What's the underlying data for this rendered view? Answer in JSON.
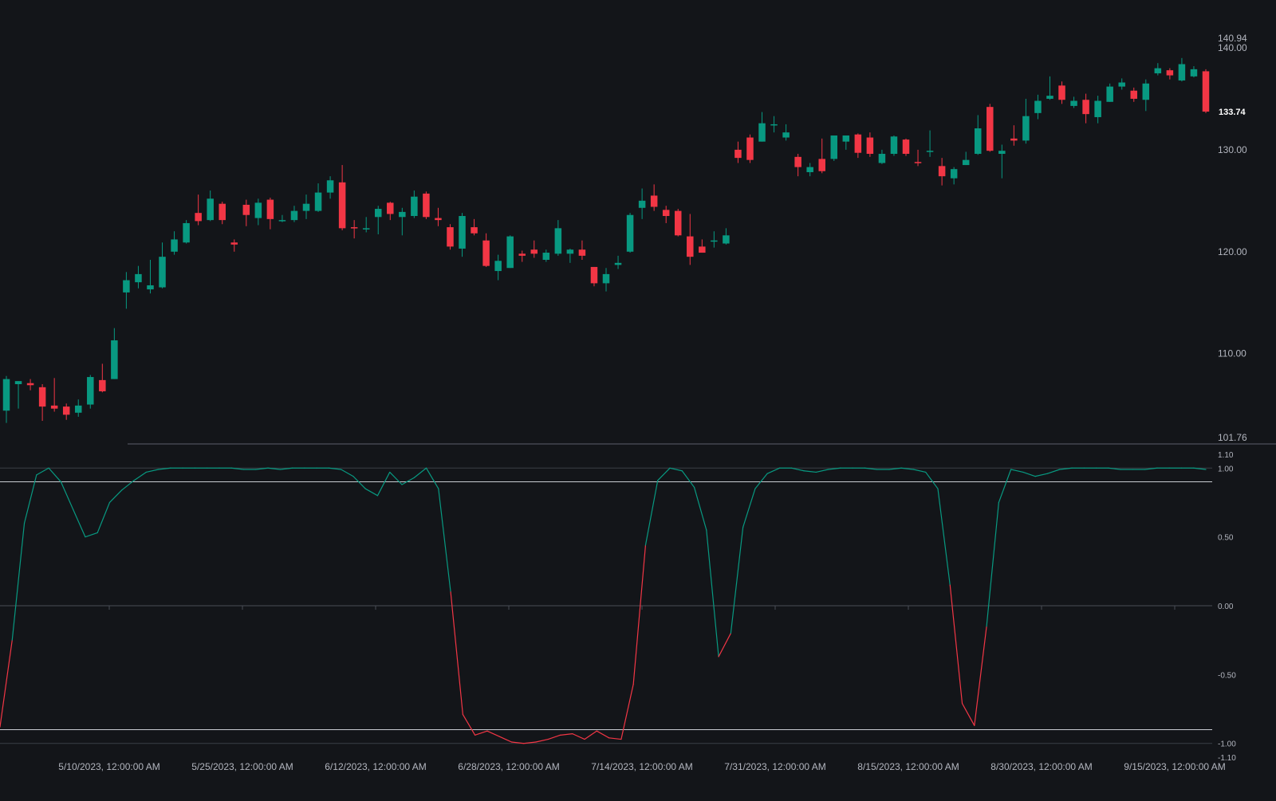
{
  "chart_data": [
    {
      "type": "candlestick",
      "panel": "price",
      "ylim": [
        101.76,
        140.94
      ],
      "y_ticks": [
        110,
        120,
        130,
        140
      ],
      "y_tick_labels": [
        "110.00",
        "120.00",
        "130.00",
        "140.00"
      ],
      "axis_extremes": [
        "140.94",
        "101.76"
      ],
      "last_price": 133.74,
      "last_price_label": "133.74",
      "candles": [
        [
          104.4,
          107.5,
          103.2,
          107.8
        ],
        [
          107.0,
          107.3,
          104.6,
          107.3
        ],
        [
          107.1,
          106.9,
          106.4,
          107.5
        ],
        [
          106.7,
          104.8,
          103.4,
          107.0
        ],
        [
          104.9,
          104.6,
          104.3,
          107.6
        ],
        [
          104.8,
          104.0,
          103.5,
          105.1
        ],
        [
          104.2,
          104.9,
          103.8,
          105.5
        ],
        [
          105.0,
          107.7,
          104.6,
          107.9
        ],
        [
          107.4,
          106.3,
          106.2,
          109.0
        ],
        [
          107.5,
          111.3,
          107.5,
          112.5
        ],
        [
          116.0,
          117.2,
          114.4,
          118.0
        ],
        [
          117.0,
          117.8,
          116.4,
          118.6
        ],
        [
          116.3,
          116.7,
          115.9,
          119.2
        ],
        [
          116.5,
          119.5,
          116.4,
          120.9
        ],
        [
          120.0,
          121.2,
          119.7,
          122.0
        ],
        [
          120.9,
          122.8,
          120.8,
          123.1
        ],
        [
          123.8,
          123.0,
          122.6,
          125.6
        ],
        [
          123.1,
          125.2,
          123.0,
          126.0
        ],
        [
          124.7,
          123.1,
          122.7,
          124.9
        ],
        [
          120.9,
          120.7,
          120.0,
          121.2
        ],
        [
          124.6,
          123.6,
          122.5,
          125.1
        ],
        [
          123.3,
          124.8,
          122.6,
          125.2
        ],
        [
          125.1,
          123.2,
          122.2,
          125.3
        ],
        [
          123.0,
          123.1,
          122.9,
          123.6
        ],
        [
          123.1,
          124.0,
          122.9,
          124.5
        ],
        [
          124.0,
          124.7,
          123.2,
          125.6
        ],
        [
          124.0,
          125.8,
          123.9,
          126.7
        ],
        [
          125.8,
          127.0,
          125.2,
          127.4
        ],
        [
          126.8,
          122.3,
          122.1,
          128.5
        ],
        [
          122.4,
          122.3,
          121.3,
          123.1
        ],
        [
          122.3,
          122.3,
          121.9,
          123.4
        ],
        [
          123.4,
          124.2,
          121.7,
          124.5
        ],
        [
          124.8,
          123.7,
          123.1,
          124.9
        ],
        [
          123.4,
          123.9,
          121.6,
          124.3
        ],
        [
          123.5,
          125.4,
          123.3,
          126.0
        ],
        [
          125.7,
          123.4,
          123.2,
          125.9
        ],
        [
          123.3,
          123.1,
          122.5,
          124.3
        ],
        [
          122.4,
          120.5,
          120.2,
          122.7
        ],
        [
          120.3,
          123.5,
          119.5,
          123.8
        ],
        [
          122.4,
          121.8,
          121.6,
          123.2
        ],
        [
          121.1,
          118.6,
          118.5,
          121.8
        ],
        [
          118.1,
          119.1,
          117.2,
          119.7
        ],
        [
          118.4,
          121.5,
          118.4,
          121.6
        ],
        [
          119.8,
          119.6,
          119.0,
          120.1
        ],
        [
          120.2,
          119.8,
          119.4,
          121.1
        ],
        [
          119.2,
          119.9,
          119.0,
          120.2
        ],
        [
          119.8,
          122.3,
          119.6,
          123.1
        ],
        [
          119.8,
          120.2,
          118.9,
          120.3
        ],
        [
          120.2,
          119.6,
          119.2,
          121.1
        ],
        [
          118.5,
          116.9,
          116.6,
          118.5
        ],
        [
          116.9,
          117.8,
          116.1,
          118.4
        ],
        [
          118.7,
          118.9,
          118.3,
          119.6
        ],
        [
          120.0,
          123.6,
          119.9,
          123.8
        ],
        [
          124.3,
          125.0,
          123.2,
          126.2
        ],
        [
          125.5,
          124.4,
          124.0,
          126.6
        ],
        [
          124.1,
          123.5,
          122.8,
          124.5
        ],
        [
          124.0,
          121.6,
          121.5,
          124.2
        ],
        [
          121.5,
          119.5,
          118.7,
          123.7
        ],
        [
          120.5,
          119.9,
          119.9,
          121.2
        ],
        [
          121.1,
          121.1,
          120.4,
          122.0
        ],
        [
          120.8,
          121.6,
          120.7,
          122.3
        ],
        [
          130.0,
          129.2,
          128.7,
          130.8
        ],
        [
          131.2,
          129.0,
          128.7,
          131.5
        ],
        [
          130.8,
          132.6,
          130.8,
          133.7
        ],
        [
          132.4,
          132.5,
          131.7,
          133.3
        ],
        [
          131.2,
          131.7,
          130.9,
          132.5
        ],
        [
          129.3,
          128.3,
          127.4,
          129.6
        ],
        [
          127.8,
          128.3,
          127.4,
          128.7
        ],
        [
          129.1,
          127.9,
          127.7,
          131.1
        ],
        [
          129.1,
          131.4,
          128.9,
          131.4
        ],
        [
          130.8,
          131.4,
          130.0,
          131.4
        ],
        [
          131.5,
          129.7,
          129.2,
          131.6
        ],
        [
          131.2,
          129.6,
          129.3,
          131.7
        ],
        [
          128.7,
          129.6,
          128.6,
          130.0
        ],
        [
          129.6,
          131.3,
          129.4,
          131.4
        ],
        [
          131.0,
          129.6,
          129.4,
          131.1
        ],
        [
          128.8,
          128.7,
          128.4,
          130.0
        ],
        [
          129.8,
          129.9,
          129.3,
          131.9
        ],
        [
          128.4,
          127.4,
          126.5,
          129.2
        ],
        [
          127.2,
          128.1,
          126.6,
          128.3
        ],
        [
          128.5,
          129.0,
          128.5,
          129.8
        ],
        [
          129.6,
          132.1,
          129.5,
          133.4
        ],
        [
          134.2,
          129.9,
          129.8,
          134.5
        ],
        [
          129.6,
          129.9,
          127.2,
          130.5
        ],
        [
          131.1,
          130.9,
          130.4,
          132.4
        ],
        [
          130.9,
          133.3,
          130.6,
          135.0
        ],
        [
          133.6,
          134.8,
          133.0,
          135.4
        ],
        [
          135.0,
          135.3,
          134.9,
          137.2
        ],
        [
          136.3,
          134.9,
          134.5,
          136.7
        ],
        [
          134.3,
          134.8,
          134.1,
          135.2
        ],
        [
          134.9,
          133.5,
          132.6,
          135.5
        ],
        [
          133.2,
          134.8,
          132.6,
          135.3
        ],
        [
          134.7,
          136.2,
          134.7,
          136.5
        ],
        [
          136.2,
          136.6,
          135.9,
          137.0
        ],
        [
          135.8,
          135.0,
          134.7,
          136.1
        ],
        [
          134.9,
          136.5,
          133.8,
          136.9
        ],
        [
          137.5,
          138.0,
          137.3,
          138.5
        ],
        [
          137.8,
          137.3,
          136.9,
          138.0
        ],
        [
          136.8,
          138.4,
          136.7,
          139.0
        ],
        [
          137.2,
          137.9,
          137.1,
          138.2
        ],
        [
          137.7,
          133.74,
          133.6,
          137.9
        ]
      ]
    },
    {
      "type": "line",
      "panel": "oscillator",
      "ylim": [
        -1.1,
        1.1
      ],
      "y_ticks": [
        -1.1,
        -1.0,
        -0.5,
        0.0,
        0.5,
        1.0,
        1.1
      ],
      "y_tick_labels": [
        "-1.10",
        "-1.00",
        "-0.50",
        "0.00",
        "0.50",
        "1.00",
        "1.10"
      ],
      "reference_lines": [
        0.9,
        -0.9,
        0
      ],
      "colors": {
        "positive": "#089981",
        "negative": "#f23645"
      },
      "x_labels": [
        "5/10/2023, 12:00:00 AM",
        "5/25/2023, 12:00:00 AM",
        "6/12/2023, 12:00:00 AM",
        "6/28/2023, 12:00:00 AM",
        "7/14/2023, 12:00:00 AM",
        "7/31/2023, 12:00:00 AM",
        "8/15/2023, 12:00:00 AM",
        "8/30/2023, 12:00:00 AM",
        "9/15/2023, 12:00:00 AM"
      ],
      "values": [
        -0.88,
        -0.25,
        0.6,
        0.95,
        1.0,
        0.9,
        0.7,
        0.5,
        0.53,
        0.75,
        0.84,
        0.91,
        0.97,
        0.99,
        1.0,
        1.0,
        1.0,
        1.0,
        1.0,
        1.0,
        0.99,
        0.99,
        1.0,
        0.99,
        1.0,
        1.0,
        1.0,
        1.0,
        0.99,
        0.94,
        0.85,
        0.8,
        0.97,
        0.88,
        0.93,
        1.0,
        0.85,
        0.1,
        -0.79,
        -0.94,
        -0.91,
        -0.95,
        -0.99,
        -1.0,
        -0.99,
        -0.97,
        -0.94,
        -0.93,
        -0.97,
        -0.91,
        -0.96,
        -0.97,
        -0.57,
        0.44,
        0.91,
        1.0,
        0.98,
        0.86,
        0.55,
        -0.37,
        -0.2,
        0.57,
        0.85,
        0.96,
        1.0,
        1.0,
        0.98,
        0.97,
        0.99,
        1.0,
        1.0,
        1.0,
        0.99,
        0.99,
        1.0,
        0.99,
        0.97,
        0.85,
        0.15,
        -0.71,
        -0.87,
        -0.15,
        0.75,
        0.99,
        0.97,
        0.94,
        0.96,
        0.99,
        1.0,
        1.0,
        1.0,
        1.0,
        0.99,
        0.99,
        0.99,
        1.0,
        1.0,
        1.0,
        1.0,
        0.99
      ]
    }
  ]
}
